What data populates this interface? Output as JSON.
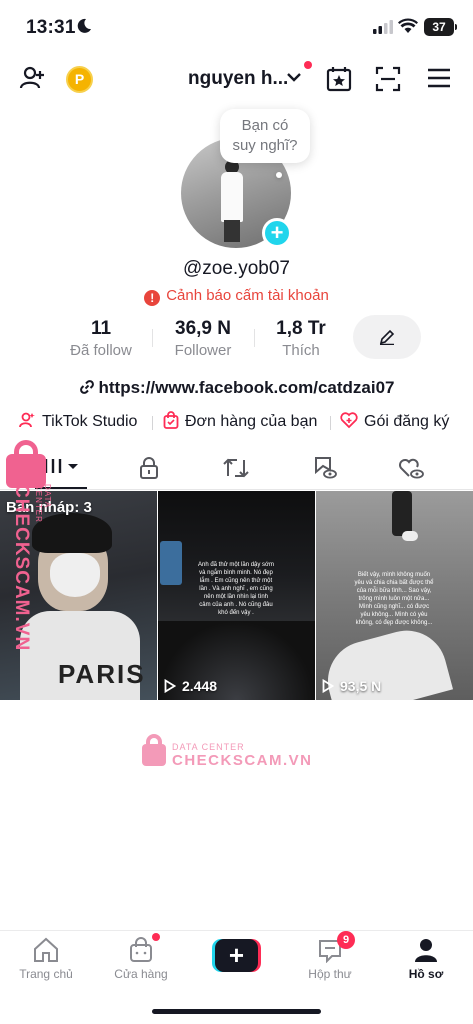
{
  "status_bar": {
    "time": "13:31",
    "battery": "37"
  },
  "header": {
    "username_short": "nguyen h...",
    "coin_label": "P"
  },
  "profile": {
    "bubble_line1": "Bạn có",
    "bubble_line2": "suy nghĩ?",
    "handle": "@zoe.yob07",
    "warning": "Cảnh báo cấm tài khoản",
    "stats": [
      {
        "value": "11",
        "label": "Đã follow"
      },
      {
        "value": "36,9 N",
        "label": "Follower"
      },
      {
        "value": "1,8 Tr",
        "label": "Thích"
      }
    ],
    "link": "https://www.facebook.com/catdzai07",
    "quick_links": [
      "TikTok Studio",
      "Đơn hàng của bạn",
      "Gói đăng ký"
    ]
  },
  "grid": {
    "draft_label": "Bản nháp: 3",
    "shirt_text": "PARIS",
    "video2_caption": "Anh đã thử một lần dậy sớm và ngắm bình minh. Nó đẹp lắm . Em cũng nên thử một lần . Và anh nghĩ , em cũng nên một lần nhìn lại tình cảm của anh . Nó cũng đâu khó đến vậy .",
    "video3_caption": "Biết vậy, mình không muốn yêu và chia chia bất được thể của mỗi bữa tình... Sao vậy, trông mình luôn một nửa... Mình cũng nghĩ... có được yêu không... Mình có yêu không, có đẹp được không...",
    "views": [
      "2.448",
      "93,5 N"
    ]
  },
  "watermark": {
    "small": "DATA CENTER",
    "big": "CHECKSCAM.VN"
  },
  "bottom_nav": {
    "home": "Trang chủ",
    "shop": "Cửa hàng",
    "create": "+",
    "inbox": "Hộp thư",
    "inbox_badge": "9",
    "profile": "Hồ sơ"
  },
  "colors": {
    "accent": "#fe2c55",
    "cyan": "#20d5ec",
    "warning": "#e8453c",
    "watermark": "#f06290"
  }
}
